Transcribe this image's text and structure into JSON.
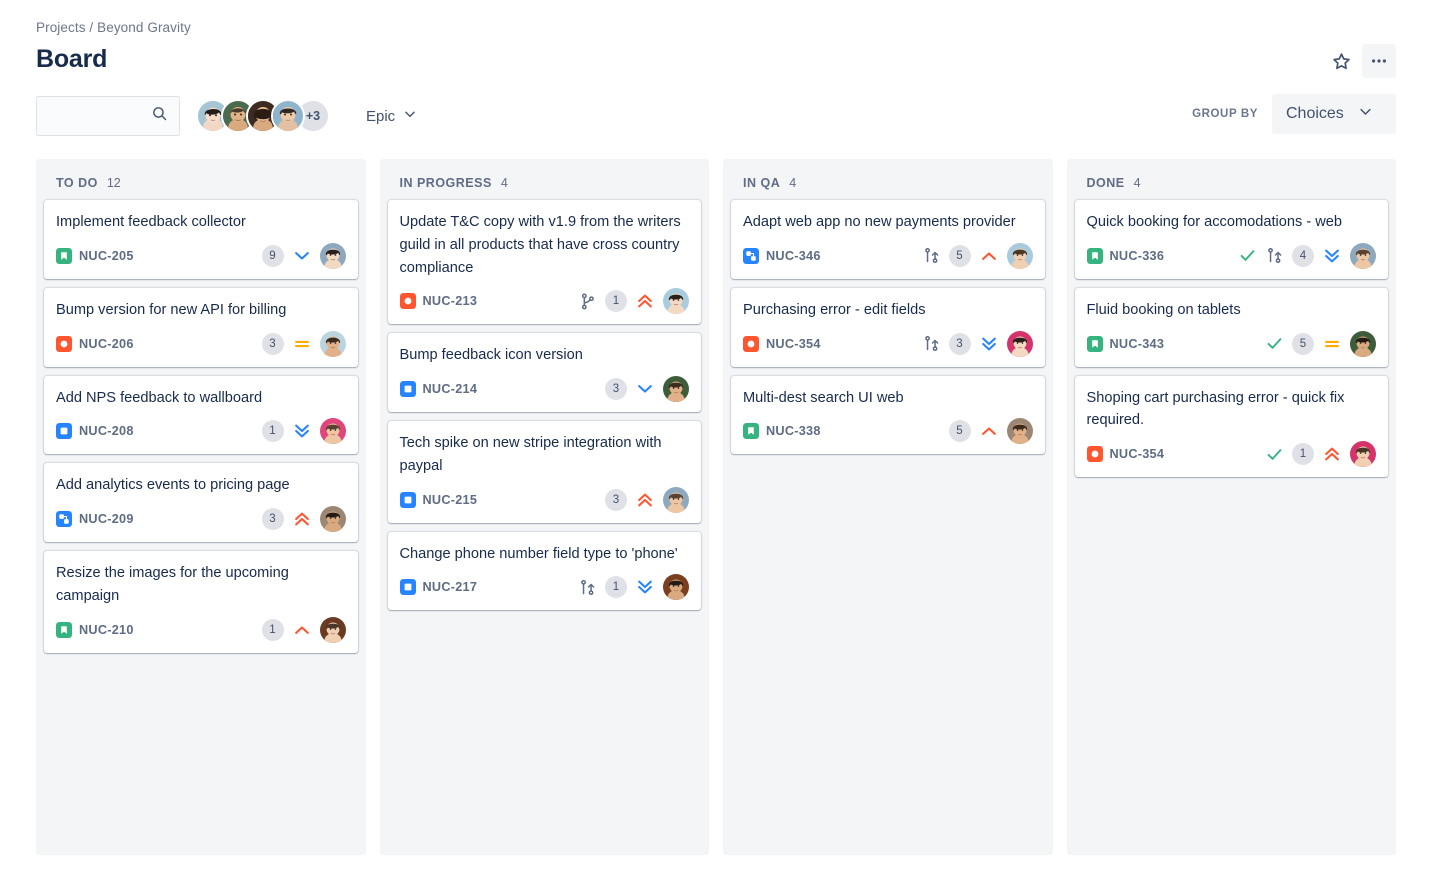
{
  "header": {
    "breadcrumb": "Projects / Beyond Gravity",
    "title": "Board",
    "star_icon": "star-icon",
    "more_icon": "more-actions-icon"
  },
  "toolbar": {
    "search": {
      "value": "",
      "placeholder": "",
      "icon": "search-icon"
    },
    "avatars": [
      {
        "name": "avatar-1",
        "bg": "#a5c4d4"
      },
      {
        "name": "avatar-2",
        "bg": "#4a6b4e"
      },
      {
        "name": "avatar-3",
        "bg": "#3d2b23"
      },
      {
        "name": "avatar-4",
        "bg": "#8fb5cc"
      }
    ],
    "avatar_overflow": "+3",
    "epic_label": "Epic",
    "epic_chevron": "chevron-down-icon",
    "group_by_label": "GROUP BY",
    "group_by_value": "Choices",
    "group_by_chevron": "chevron-down-icon"
  },
  "colors": {
    "story": "#36b37e",
    "bug": "#ff5630",
    "task": "#2684ff",
    "subtask": "#2684ff",
    "priority_high": "#ff5630",
    "priority_medium": "#ffab00",
    "priority_low": "#2684ff",
    "done_check": "#36b37e",
    "column_bg": "#f4f5f7"
  },
  "columns": [
    {
      "name": "TO DO",
      "count": "12",
      "cards": [
        {
          "title": "Implement feedback collector",
          "key": "NUC-205",
          "type": "story",
          "done": false,
          "dev_icon": "",
          "count": "9",
          "priority": "low",
          "avatar_bg": "#8ea9bd"
        },
        {
          "title": "Bump version for new API for billing",
          "key": "NUC-206",
          "type": "bug",
          "done": false,
          "dev_icon": "",
          "count": "3",
          "priority": "medium",
          "avatar_bg": "#bcd4e0"
        },
        {
          "title": "Add NPS feedback to wallboard",
          "key": "NUC-208",
          "type": "task",
          "done": false,
          "dev_icon": "",
          "count": "1",
          "priority": "lowest",
          "avatar_bg": "#e0457b"
        },
        {
          "title": "Add analytics events to pricing page",
          "key": "NUC-209",
          "type": "subtask",
          "done": false,
          "dev_icon": "",
          "count": "3",
          "priority": "highest",
          "avatar_bg": "#9b8774"
        },
        {
          "title": "Resize the images for the upcoming campaign",
          "key": "NUC-210",
          "type": "story",
          "done": false,
          "dev_icon": "",
          "count": "1",
          "priority": "high",
          "avatar_bg": "#6b3a22"
        }
      ]
    },
    {
      "name": "IN PROGRESS",
      "count": "4",
      "cards": [
        {
          "title": "Update T&C copy with v1.9 from the writers guild in all products that have cross country compliance",
          "key": "NUC-213",
          "type": "bug",
          "done": false,
          "dev_icon": "branch-icon",
          "count": "1",
          "priority": "highest",
          "avatar_bg": "#a8cbdd"
        },
        {
          "title": "Bump feedback icon version",
          "key": "NUC-214",
          "type": "task",
          "done": false,
          "dev_icon": "",
          "count": "3",
          "priority": "low",
          "avatar_bg": "#3d5c3a"
        },
        {
          "title": "Tech spike on new stripe integration with paypal",
          "key": "NUC-215",
          "type": "task",
          "done": false,
          "dev_icon": "",
          "count": "3",
          "priority": "highest",
          "avatar_bg": "#8ea9bd"
        },
        {
          "title": "Change phone number field type to 'phone'",
          "key": "NUC-217",
          "type": "task",
          "done": false,
          "dev_icon": "pull-request-icon",
          "count": "1",
          "priority": "lowest",
          "avatar_bg": "#7a3f1f"
        }
      ]
    },
    {
      "name": "IN QA",
      "count": "4",
      "cards": [
        {
          "title": "Adapt web app no new payments provider",
          "key": "NUC-346",
          "type": "subtask",
          "done": false,
          "dev_icon": "pull-request-icon",
          "count": "5",
          "priority": "high",
          "avatar_bg": "#a9c9dc"
        },
        {
          "title": "Purchasing error - edit fields",
          "key": "NUC-354",
          "type": "bug",
          "done": false,
          "dev_icon": "pull-request-icon",
          "count": "3",
          "priority": "lowest",
          "avatar_bg": "#d4336c"
        },
        {
          "title": "Multi-dest search UI web",
          "key": "NUC-338",
          "type": "story",
          "done": false,
          "dev_icon": "",
          "count": "5",
          "priority": "high",
          "avatar_bg": "#9b8774"
        }
      ]
    },
    {
      "name": "DONE",
      "count": "4",
      "cards": [
        {
          "title": "Quick booking for accomodations - web",
          "key": "NUC-336",
          "type": "story",
          "done": true,
          "dev_icon": "pull-request-icon",
          "count": "4",
          "priority": "lowest",
          "avatar_bg": "#8ea9bd"
        },
        {
          "title": "Fluid booking on tablets",
          "key": "NUC-343",
          "type": "story",
          "done": true,
          "dev_icon": "",
          "count": "5",
          "priority": "medium",
          "avatar_bg": "#3d5c3a"
        },
        {
          "title": "Shoping cart purchasing error - quick fix required.",
          "key": "NUC-354",
          "type": "bug",
          "done": true,
          "dev_icon": "",
          "count": "1",
          "priority": "highest",
          "avatar_bg": "#d4336c"
        }
      ]
    }
  ]
}
